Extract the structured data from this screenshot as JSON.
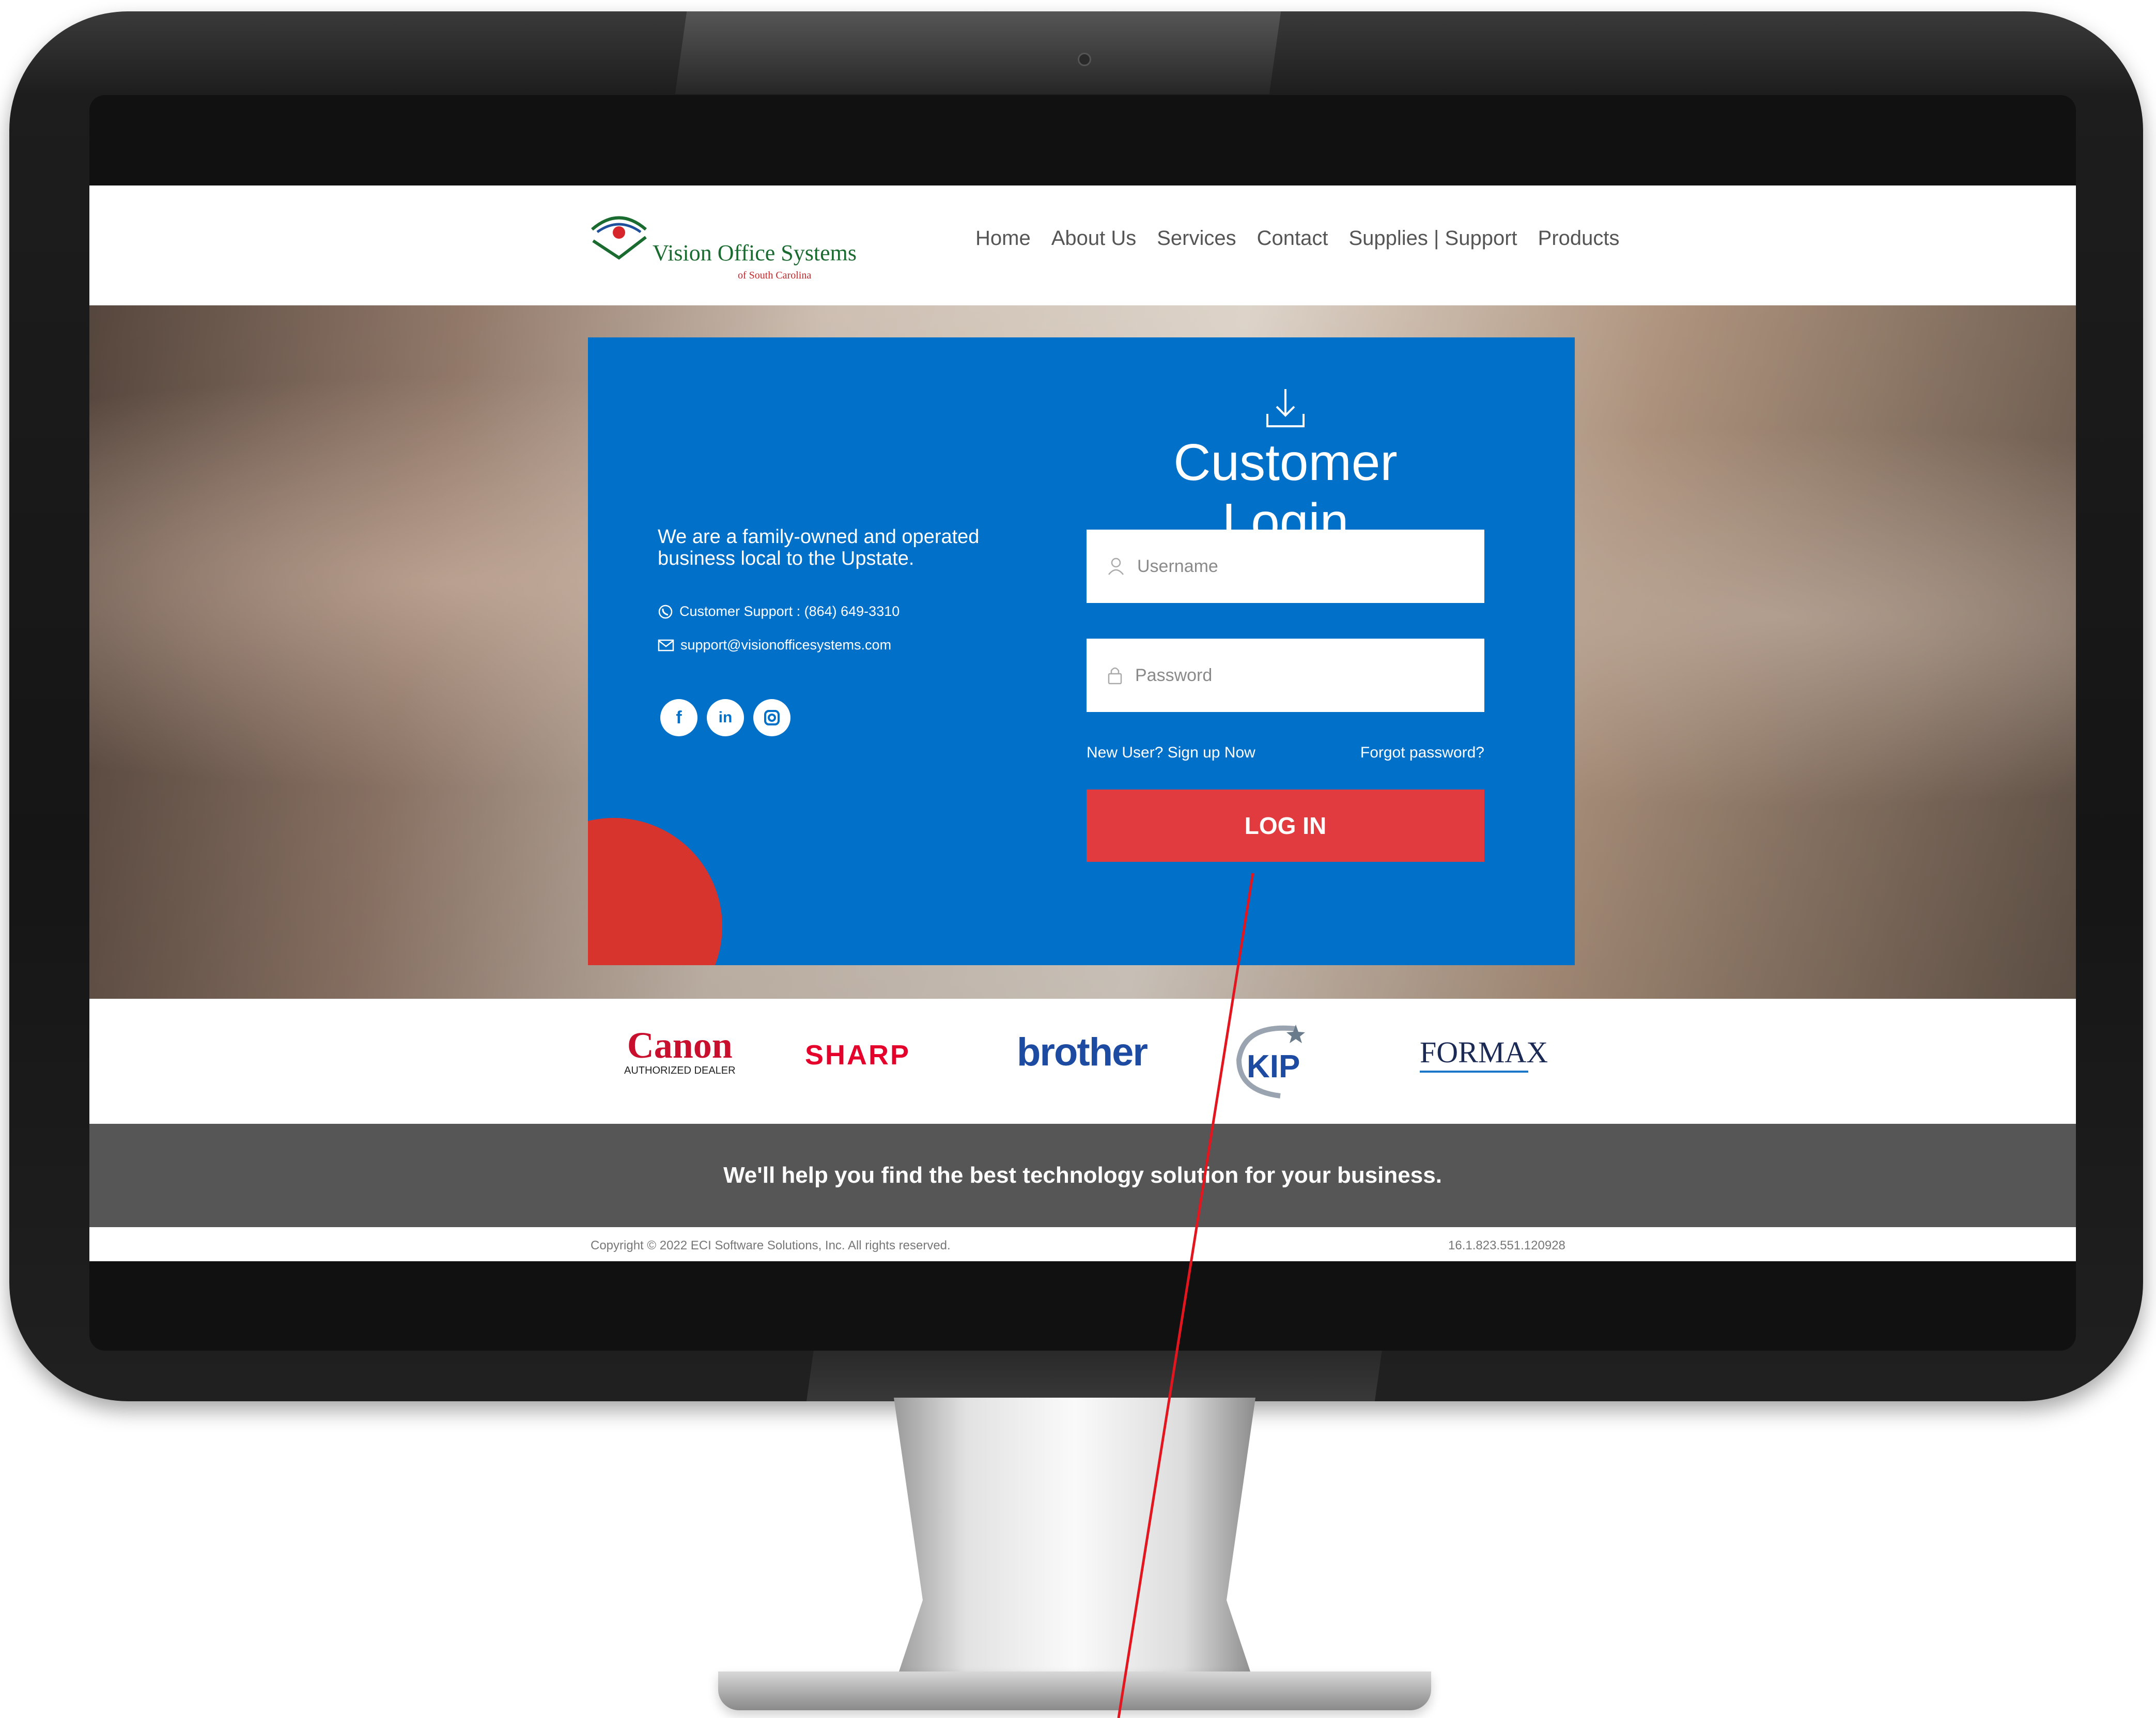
{
  "header": {
    "logo_name": "Vision Office Systems",
    "logo_sub": "of South Carolina",
    "nav": [
      "Home",
      "About Us",
      "Services",
      "Contact",
      "Supplies | Support",
      "Products"
    ]
  },
  "login_card": {
    "about_text": "We are a family-owned and operated business local to the Upstate.",
    "phone": "Customer Support : (864) 649-3310",
    "email": "support@visionofficesystems.com",
    "socials": [
      "facebook-icon",
      "linkedin-icon",
      "instagram-icon"
    ],
    "title": "Customer Login",
    "username_placeholder": "Username",
    "password_placeholder": "Password",
    "signup_link": "New User? Sign up Now",
    "forgot_link": "Forgot password?",
    "login_button": "LOG IN"
  },
  "brands": {
    "canon": "Canon",
    "canon_sub": "AUTHORIZED DEALER",
    "sharp": "SHARP",
    "brother": "brother",
    "kip": "KIP",
    "formax": "FORMAX"
  },
  "tagline": "We'll help you find the best technology solution for your business.",
  "footer": {
    "copyright": "Copyright © 2022 ECI Software Solutions, Inc. All rights reserved.",
    "version": "16.1.823.551.120928"
  },
  "colors": {
    "card_blue": "#0070c9",
    "button_red": "#e23b3f",
    "tagline_gray": "#565656",
    "annotation_red": "#e3151f"
  }
}
